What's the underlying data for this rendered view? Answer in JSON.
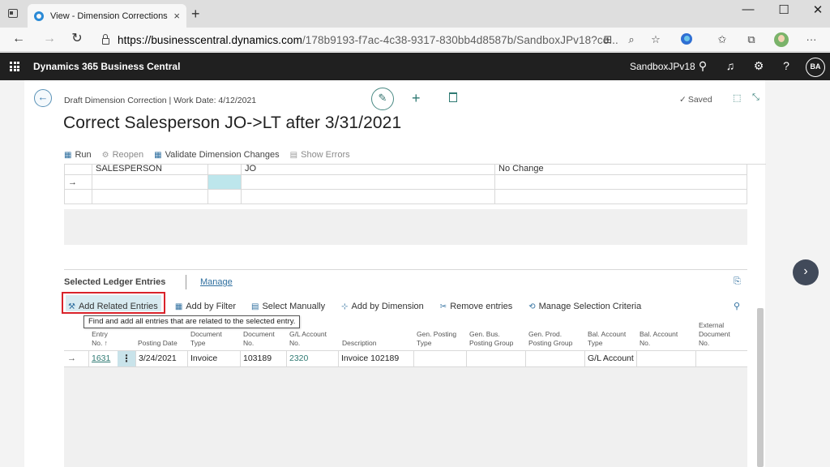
{
  "browser": {
    "tab_title": "View - Dimension Corrections - D",
    "tab_close": "×",
    "new_tab": "+",
    "window_controls": {
      "minimize": "—",
      "maximize": "☐",
      "close": "✕"
    },
    "nav": {
      "back": "←",
      "forward": "→",
      "refresh": "↻"
    },
    "url_host": "https://businesscentral.dynamics.com",
    "url_path": "/178b9193-f7ac-4c38-9317-830bb4d8587b/SandboxJPv18?co...",
    "toolbar_icons": [
      "immersive-reader-icon",
      "zoom-icon",
      "favorite-icon",
      "edge-icon",
      "favorites-icon",
      "collections-icon",
      "profile-icon",
      "more-icon"
    ]
  },
  "bc": {
    "product": "Dynamics 365 Business Central",
    "environment": "SandboxJPv18",
    "avatar": "BA"
  },
  "page": {
    "breadcrumb": "Draft Dimension Correction | Work Date: 4/12/2021",
    "title": "Correct Salesperson JO->LT after 3/31/2021",
    "saved": "Saved",
    "actions": [
      {
        "label": "Run",
        "icon": "run-icon",
        "enabled": true
      },
      {
        "label": "Reopen",
        "icon": "reopen-icon",
        "enabled": false
      },
      {
        "label": "Validate Dimension Changes",
        "icon": "validate-icon",
        "enabled": true
      },
      {
        "label": "Show Errors",
        "icon": "errors-icon",
        "enabled": false
      }
    ],
    "dim_rows": [
      {
        "code": "SALESPERSON",
        "value": "JO",
        "action": "No Change"
      }
    ],
    "row_arrow": "→"
  },
  "ledger": {
    "title": "Selected Ledger Entries",
    "manage": "Manage",
    "actions": {
      "add_related": "Add Related Entries",
      "add_filter": "Add by Filter",
      "select_manually": "Select Manually",
      "add_dimension": "Add by Dimension",
      "remove": "Remove entries",
      "criteria": "Manage Selection Criteria"
    },
    "tooltip": "Find and add all entries that are related to the selected entry.",
    "columns": {
      "entry_no": [
        "Entry",
        "No. ↑"
      ],
      "posting_date": [
        "Posting Date"
      ],
      "doc_type": [
        "Document",
        "Type"
      ],
      "doc_no": [
        "Document",
        "No."
      ],
      "gl_account": [
        "G/L Account",
        "No."
      ],
      "description": [
        "Description"
      ],
      "gen_posting": [
        "Gen. Posting",
        "Type"
      ],
      "gen_bus": [
        "Gen. Bus.",
        "Posting Group"
      ],
      "gen_prod": [
        "Gen. Prod.",
        "Posting Group"
      ],
      "bal_type": [
        "Bal. Account",
        "Type"
      ],
      "bal_no": [
        "Bal. Account",
        "No."
      ],
      "ext_doc": [
        "External",
        "Document",
        "No."
      ]
    },
    "rows": [
      {
        "entry_no": "1631",
        "posting_date": "3/24/2021",
        "doc_type": "Invoice",
        "doc_no": "103189",
        "gl_account": "2320",
        "description": "Invoice 102189",
        "gen_posting": "",
        "gen_bus": "",
        "gen_prod": "",
        "bal_type": "G/L Account",
        "bal_no": "",
        "ext_doc": ""
      }
    ],
    "row_menu": "⋮"
  },
  "side": {
    "next": "›"
  }
}
